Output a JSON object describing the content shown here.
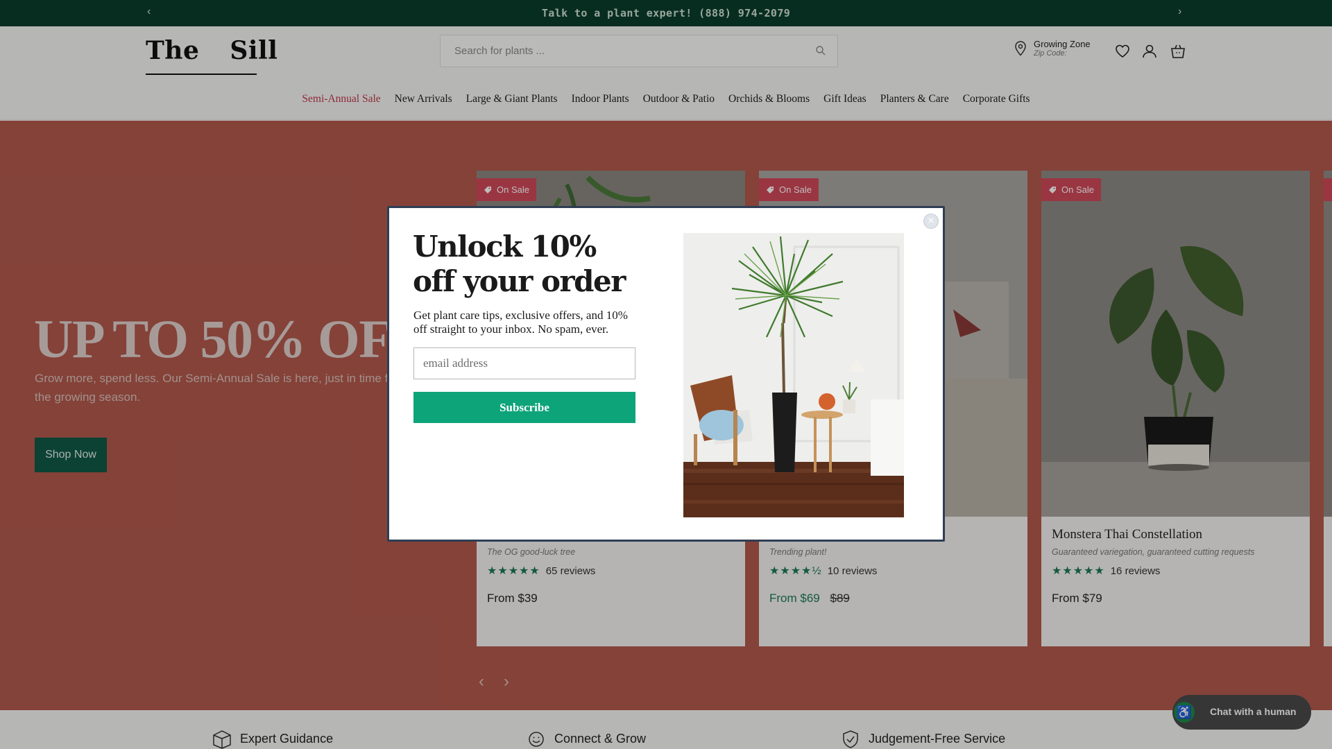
{
  "announcement": {
    "text": "Talk to a plant expert! (888) 974-2079",
    "prev_glyph": "‹",
    "next_glyph": "›"
  },
  "header": {
    "logo_left": "The",
    "logo_right": "Sill",
    "search_placeholder": "Search for plants ...",
    "zone_label": "Growing Zone",
    "zone_sub": "Zip Code:",
    "icons": [
      "location-pin-icon",
      "heart-icon",
      "account-icon",
      "cart-icon",
      "search-icon"
    ]
  },
  "nav": {
    "items": [
      "Semi-Annual Sale",
      "New Arrivals",
      "Large & Giant Plants",
      "Indoor Plants",
      "Outdoor & Patio",
      "Orchids & Blooms",
      "Gift Ideas",
      "Planters & Care",
      "Corporate Gifts"
    ]
  },
  "hero": {
    "title": "UP TO 50% OFF",
    "subtitle": "Grow more, spend less. Our Semi-Annual Sale is here, just in time for the growing season.",
    "button": "Shop Now",
    "bg_color": "#b25a4e"
  },
  "products": [
    {
      "badge": "On Sale",
      "name": "",
      "tagline": "The OG good-luck tree",
      "stars": "★★★★★",
      "reviews": "65 reviews",
      "price": "From $39",
      "original_price": ""
    },
    {
      "badge": "On Sale",
      "name": "",
      "tagline": "Trending plant!",
      "stars": "★★★★½",
      "reviews": "10 reviews",
      "price": "From $69",
      "original_price": "$89"
    },
    {
      "badge": "On Sale",
      "name": "Monstera Thai Constellation",
      "tagline": "Guaranteed variegation, guaranteed cutting requests",
      "stars": "★★★★★",
      "reviews": "16 reviews",
      "price": "From $79",
      "original_price": ""
    }
  ],
  "carousel": {
    "prev_glyph": "‹",
    "next_glyph": "›"
  },
  "features": {
    "items": [
      "Expert Guidance",
      "Connect & Grow",
      "Judgement-Free Service"
    ]
  },
  "chat": {
    "label": "Chat with a human",
    "accessibility_glyph": "♿"
  },
  "modal": {
    "title": "Unlock 10% off your order",
    "description": "Get plant care tips, exclusive offers, and 10% off straight to your inbox. No spam, ever.",
    "email_placeholder": "email address",
    "subscribe_label": "Subscribe",
    "close_glyph": "×",
    "accent_color": "#0ea47a"
  }
}
